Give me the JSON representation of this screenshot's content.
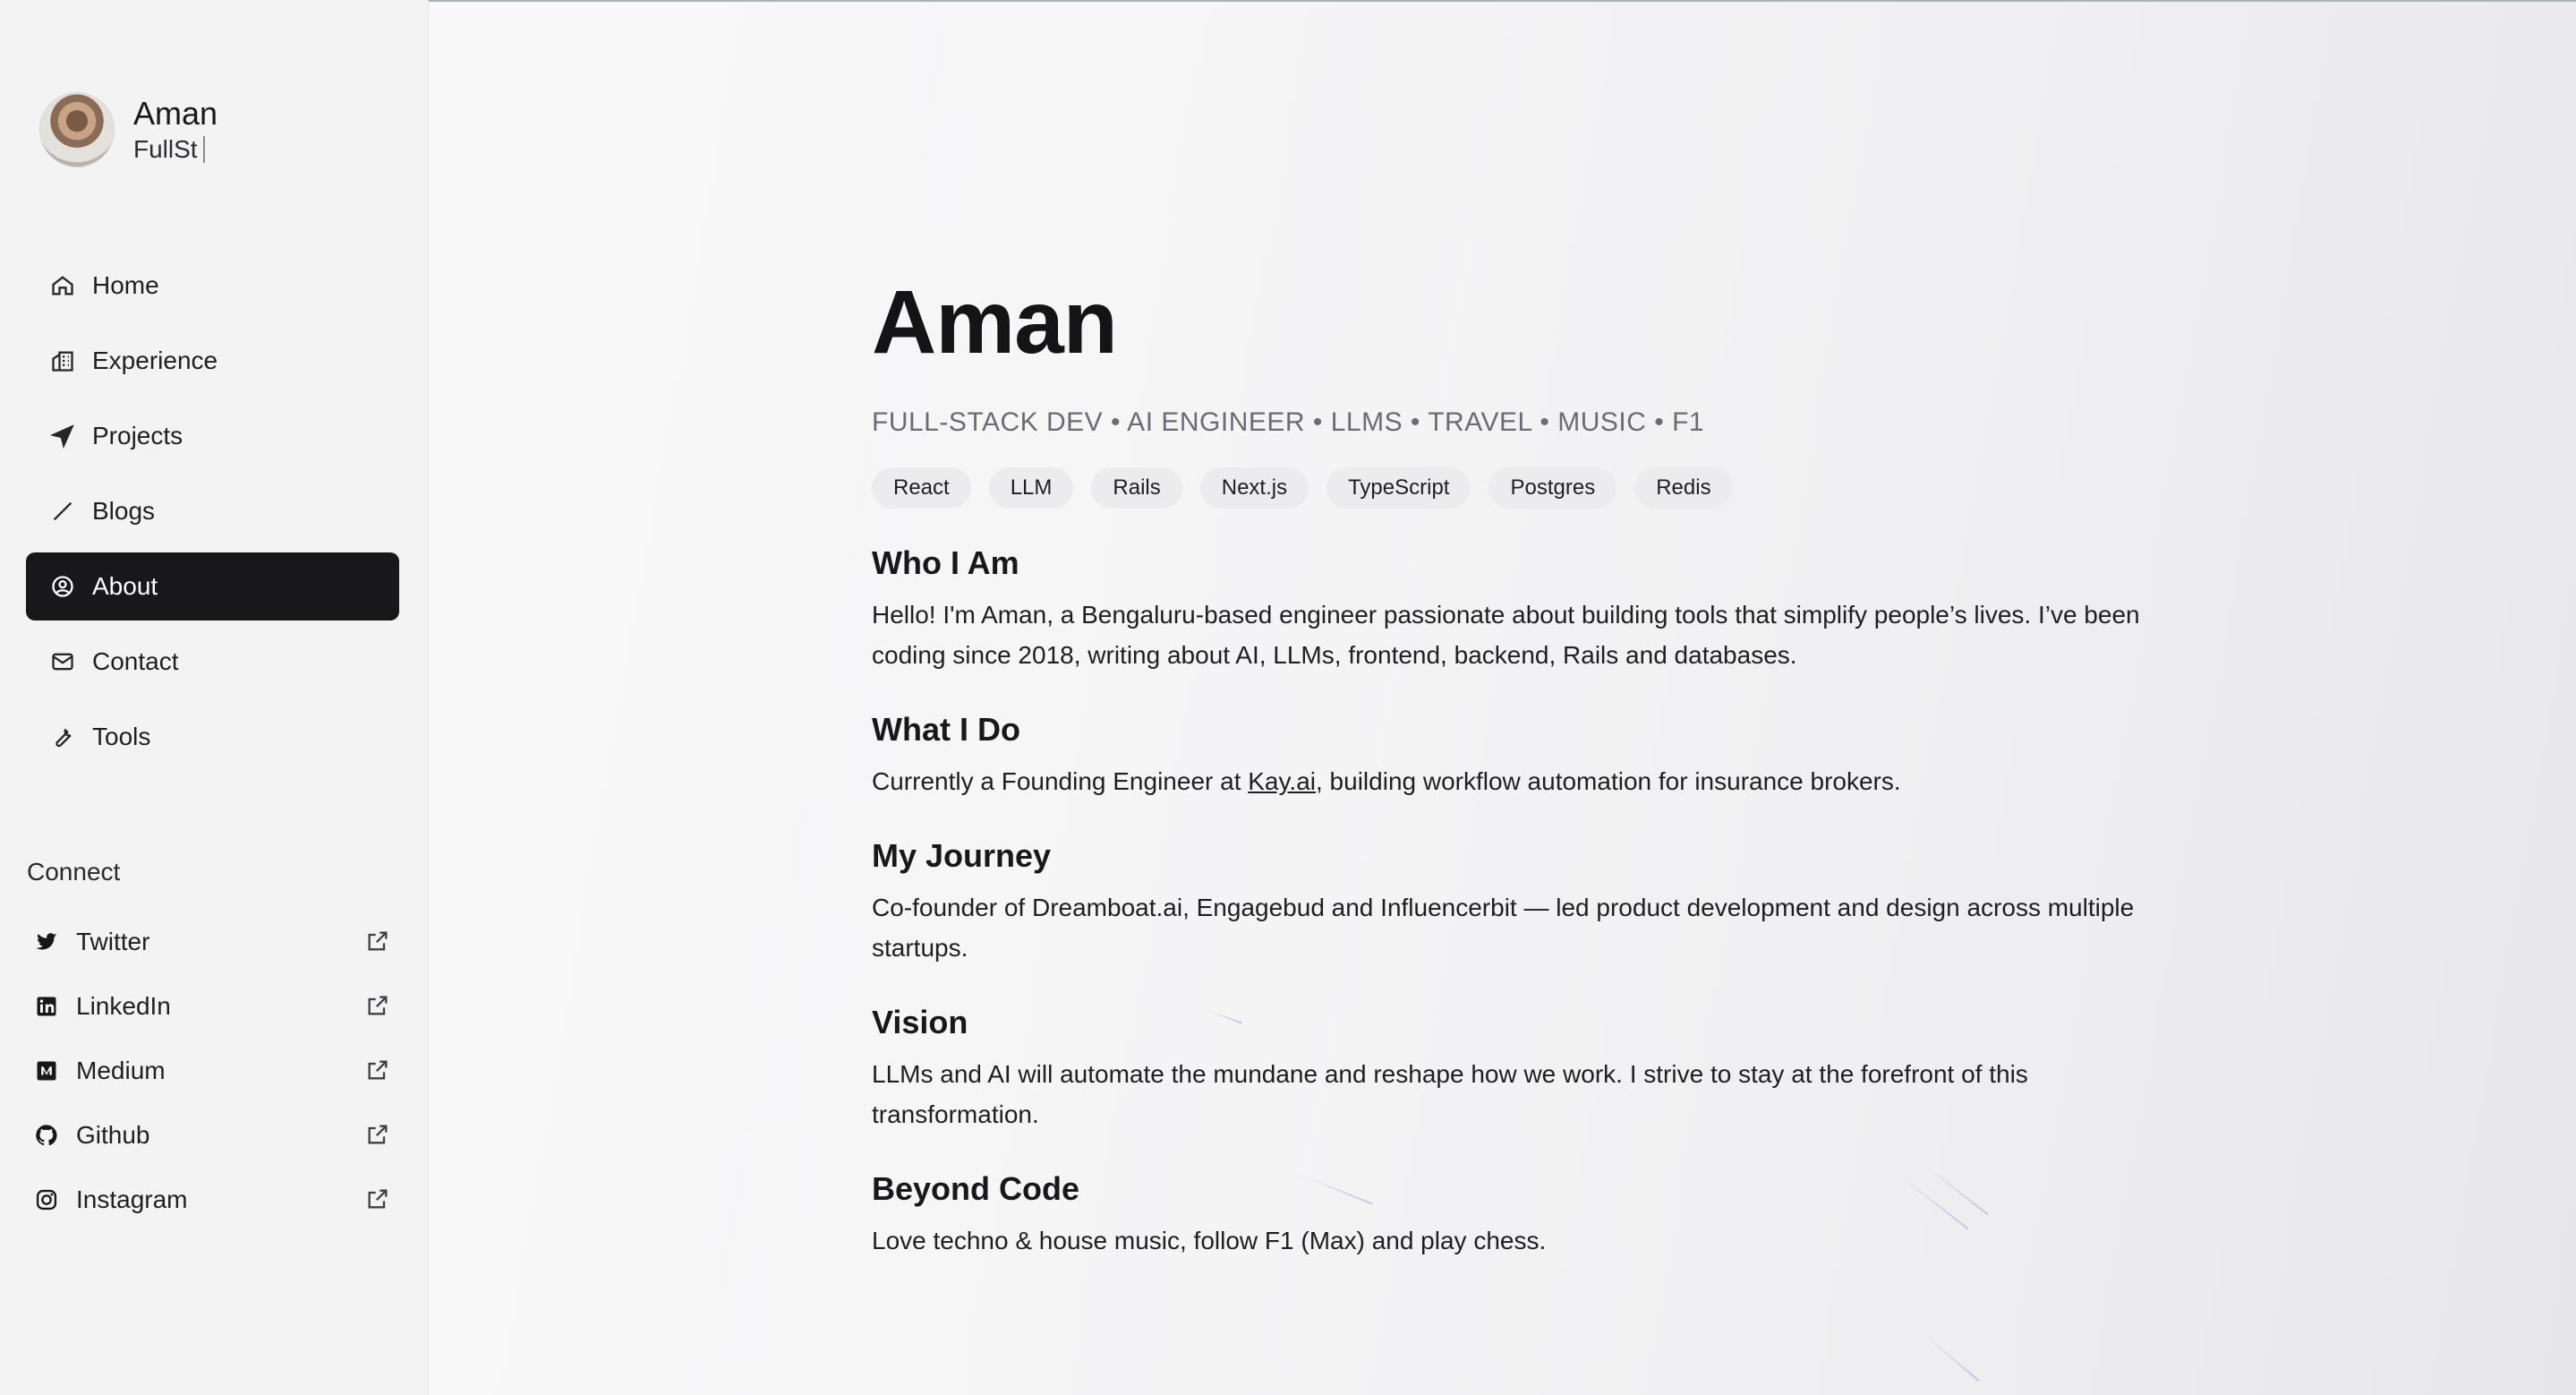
{
  "profile": {
    "name": "Aman",
    "role_typed": "FullSt"
  },
  "nav": {
    "items": [
      {
        "label": "Home",
        "icon": "home-icon"
      },
      {
        "label": "Experience",
        "icon": "building-icon"
      },
      {
        "label": "Projects",
        "icon": "send-icon"
      },
      {
        "label": "Blogs",
        "icon": "pen-icon"
      },
      {
        "label": "About",
        "icon": "user-circle-icon",
        "active": true
      },
      {
        "label": "Contact",
        "icon": "mail-icon"
      },
      {
        "label": "Tools",
        "icon": "wrench-icon"
      }
    ]
  },
  "connect": {
    "title": "Connect",
    "items": [
      {
        "label": "Twitter",
        "icon": "twitter-icon"
      },
      {
        "label": "LinkedIn",
        "icon": "linkedin-icon"
      },
      {
        "label": "Medium",
        "icon": "medium-icon"
      },
      {
        "label": "Github",
        "icon": "github-icon"
      },
      {
        "label": "Instagram",
        "icon": "instagram-icon"
      }
    ]
  },
  "main": {
    "title": "Aman",
    "tagline": "FULL-STACK DEV • AI ENGINEER • LLMS • TRAVEL • MUSIC • F1",
    "chips": [
      "React",
      "LLM",
      "Rails",
      "Next.js",
      "TypeScript",
      "Postgres",
      "Redis"
    ],
    "sections": [
      {
        "heading": "Who I Am",
        "text": "Hello! I'm Aman, a Bengaluru-based engineer passionate about building tools that simplify people’s lives. I’ve been coding since 2018, writing about AI, LLMs, frontend, backend, Rails and databases."
      },
      {
        "heading": "What I Do",
        "text_before": "Currently a Founding Engineer at ",
        "link": "Kay.ai",
        "text_after": ", building workflow automation for insurance brokers."
      },
      {
        "heading": "My Journey",
        "text": "Co-founder of Dreamboat.ai, Engagebud and Influencerbit — led product development and design across multiple startups."
      },
      {
        "heading": "Vision",
        "text": "LLMs and AI will automate the mundane and reshape how we work. I strive to stay at the forefront of this transformation."
      },
      {
        "heading": "Beyond Code",
        "text": "Love techno & house music, follow F1 (Max) and play chess."
      }
    ]
  },
  "colors": {
    "active_bg": "#18181b",
    "active_fg": "#ffffff",
    "chip_bg": "#ececee",
    "muted": "#6b6b73"
  }
}
